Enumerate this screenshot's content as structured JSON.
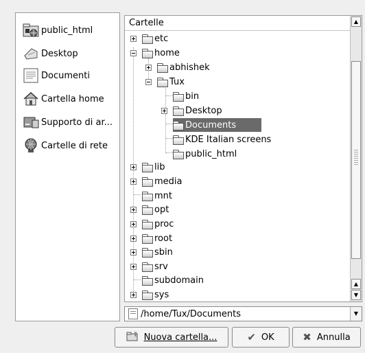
{
  "places": [
    {
      "label": "public_html",
      "icon": "web-folder-icon"
    },
    {
      "label": "Desktop",
      "icon": "desktop-icon"
    },
    {
      "label": "Documenti",
      "icon": "document-icon"
    },
    {
      "label": "Cartella home",
      "icon": "home-icon"
    },
    {
      "label": "Supporto di ar...",
      "icon": "storage-icon"
    },
    {
      "label": "Cartelle di rete",
      "icon": "network-icon"
    }
  ],
  "tree": {
    "header": "Cartelle",
    "nodes": [
      {
        "label": "etc",
        "expander": "plus"
      },
      {
        "label": "home",
        "expander": "minus"
      },
      {
        "label": "abhishek",
        "expander": "plus"
      },
      {
        "label": "Tux",
        "expander": "minus"
      },
      {
        "label": "bin",
        "expander": ""
      },
      {
        "label": "Desktop",
        "expander": "plus"
      },
      {
        "label": "Documents",
        "expander": "",
        "selected": true
      },
      {
        "label": "KDE Italian screens",
        "expander": ""
      },
      {
        "label": "public_html",
        "expander": ""
      },
      {
        "label": "lib",
        "expander": "plus"
      },
      {
        "label": "media",
        "expander": "plus"
      },
      {
        "label": "mnt",
        "expander": ""
      },
      {
        "label": "opt",
        "expander": "plus"
      },
      {
        "label": "proc",
        "expander": "plus"
      },
      {
        "label": "root",
        "expander": "plus"
      },
      {
        "label": "sbin",
        "expander": "plus"
      },
      {
        "label": "srv",
        "expander": "plus"
      },
      {
        "label": "subdomain",
        "expander": ""
      },
      {
        "label": "sys",
        "expander": "plus"
      }
    ]
  },
  "path": "/home/Tux/Documents",
  "buttons": {
    "new_folder": "Nuova cartella...",
    "ok": "OK",
    "cancel": "Annulla"
  },
  "colors": {
    "selection": "#6a6a6a",
    "background": "#efefef"
  }
}
